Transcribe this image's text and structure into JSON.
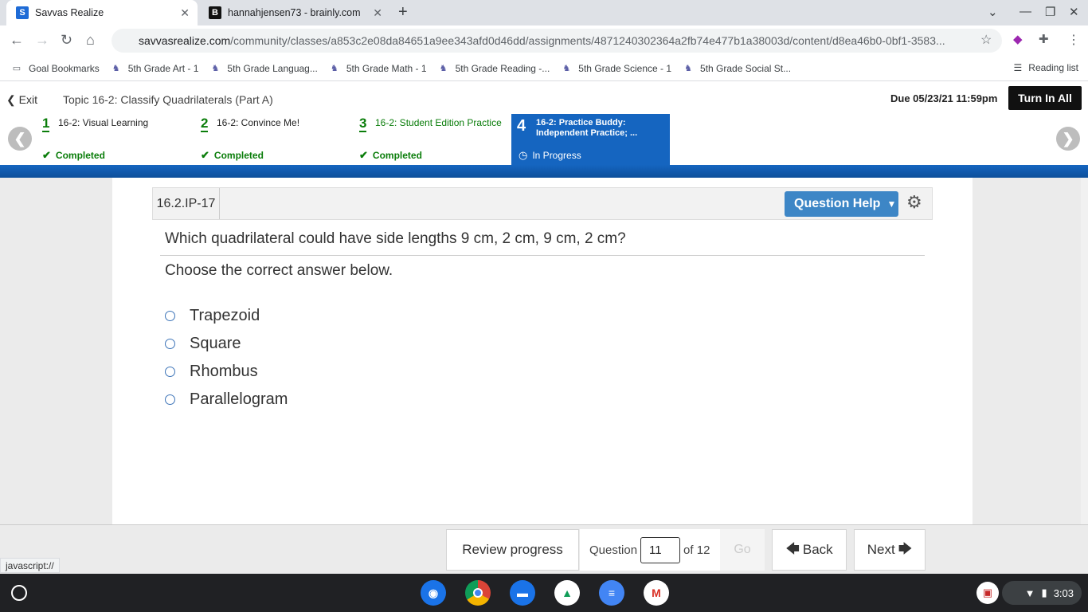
{
  "browser": {
    "tabs": [
      {
        "title": "Savvas Realize"
      },
      {
        "title": "hannahjensen73 - brainly.com"
      }
    ],
    "url_domain": "savvasrealize.com",
    "url_path": "/community/classes/a853c2e08da84651a9ee343afd0d46dd/assignments/4871240302364a2fb74e477b1a38003d/content/d8ea46b0-0bf1-3583...",
    "bookmarks": [
      "Goal Bookmarks",
      "5th Grade Art - 1",
      "5th Grade Languag...",
      "5th Grade Math - 1",
      "5th Grade Reading -...",
      "5th Grade Science - 1",
      "5th Grade Social St..."
    ],
    "reading_list": "Reading list",
    "status_url": "javascript://"
  },
  "header": {
    "exit": "Exit",
    "topic": "Topic 16-2: Classify Quadrilaterals (Part A)",
    "due": "Due 05/23/21 11:59pm",
    "turn_in": "Turn In All"
  },
  "steps": [
    {
      "num": "1",
      "title": "16-2: Visual Learning",
      "status": "Completed"
    },
    {
      "num": "2",
      "title": "16-2: Convince Me!",
      "status": "Completed"
    },
    {
      "num": "3",
      "title": "16-2: Student Edition Practice",
      "status": "Completed"
    },
    {
      "num": "4",
      "title": "16-2: Practice Buddy: Independent Practice; ...",
      "status": "In Progress"
    }
  ],
  "question": {
    "id": "16.2.IP-17",
    "help": "Question Help",
    "text": "Which quadrilateral could have side lengths 9 cm, 2 cm, 9 cm, 2 cm?",
    "instruction": "Choose the correct answer below.",
    "options": [
      "Trapezoid",
      "Square",
      "Rhombus",
      "Parallelogram"
    ]
  },
  "footer": {
    "review": "Review progress",
    "question_label": "Question",
    "current": "11",
    "of_total": "of 12",
    "go": "Go",
    "back": "Back",
    "next": "Next"
  },
  "shelf": {
    "time": "3:03"
  },
  "colors": {
    "accent_blue": "#1565c0",
    "completed_green": "#0a7d0a",
    "help_button": "#3d86c6"
  }
}
